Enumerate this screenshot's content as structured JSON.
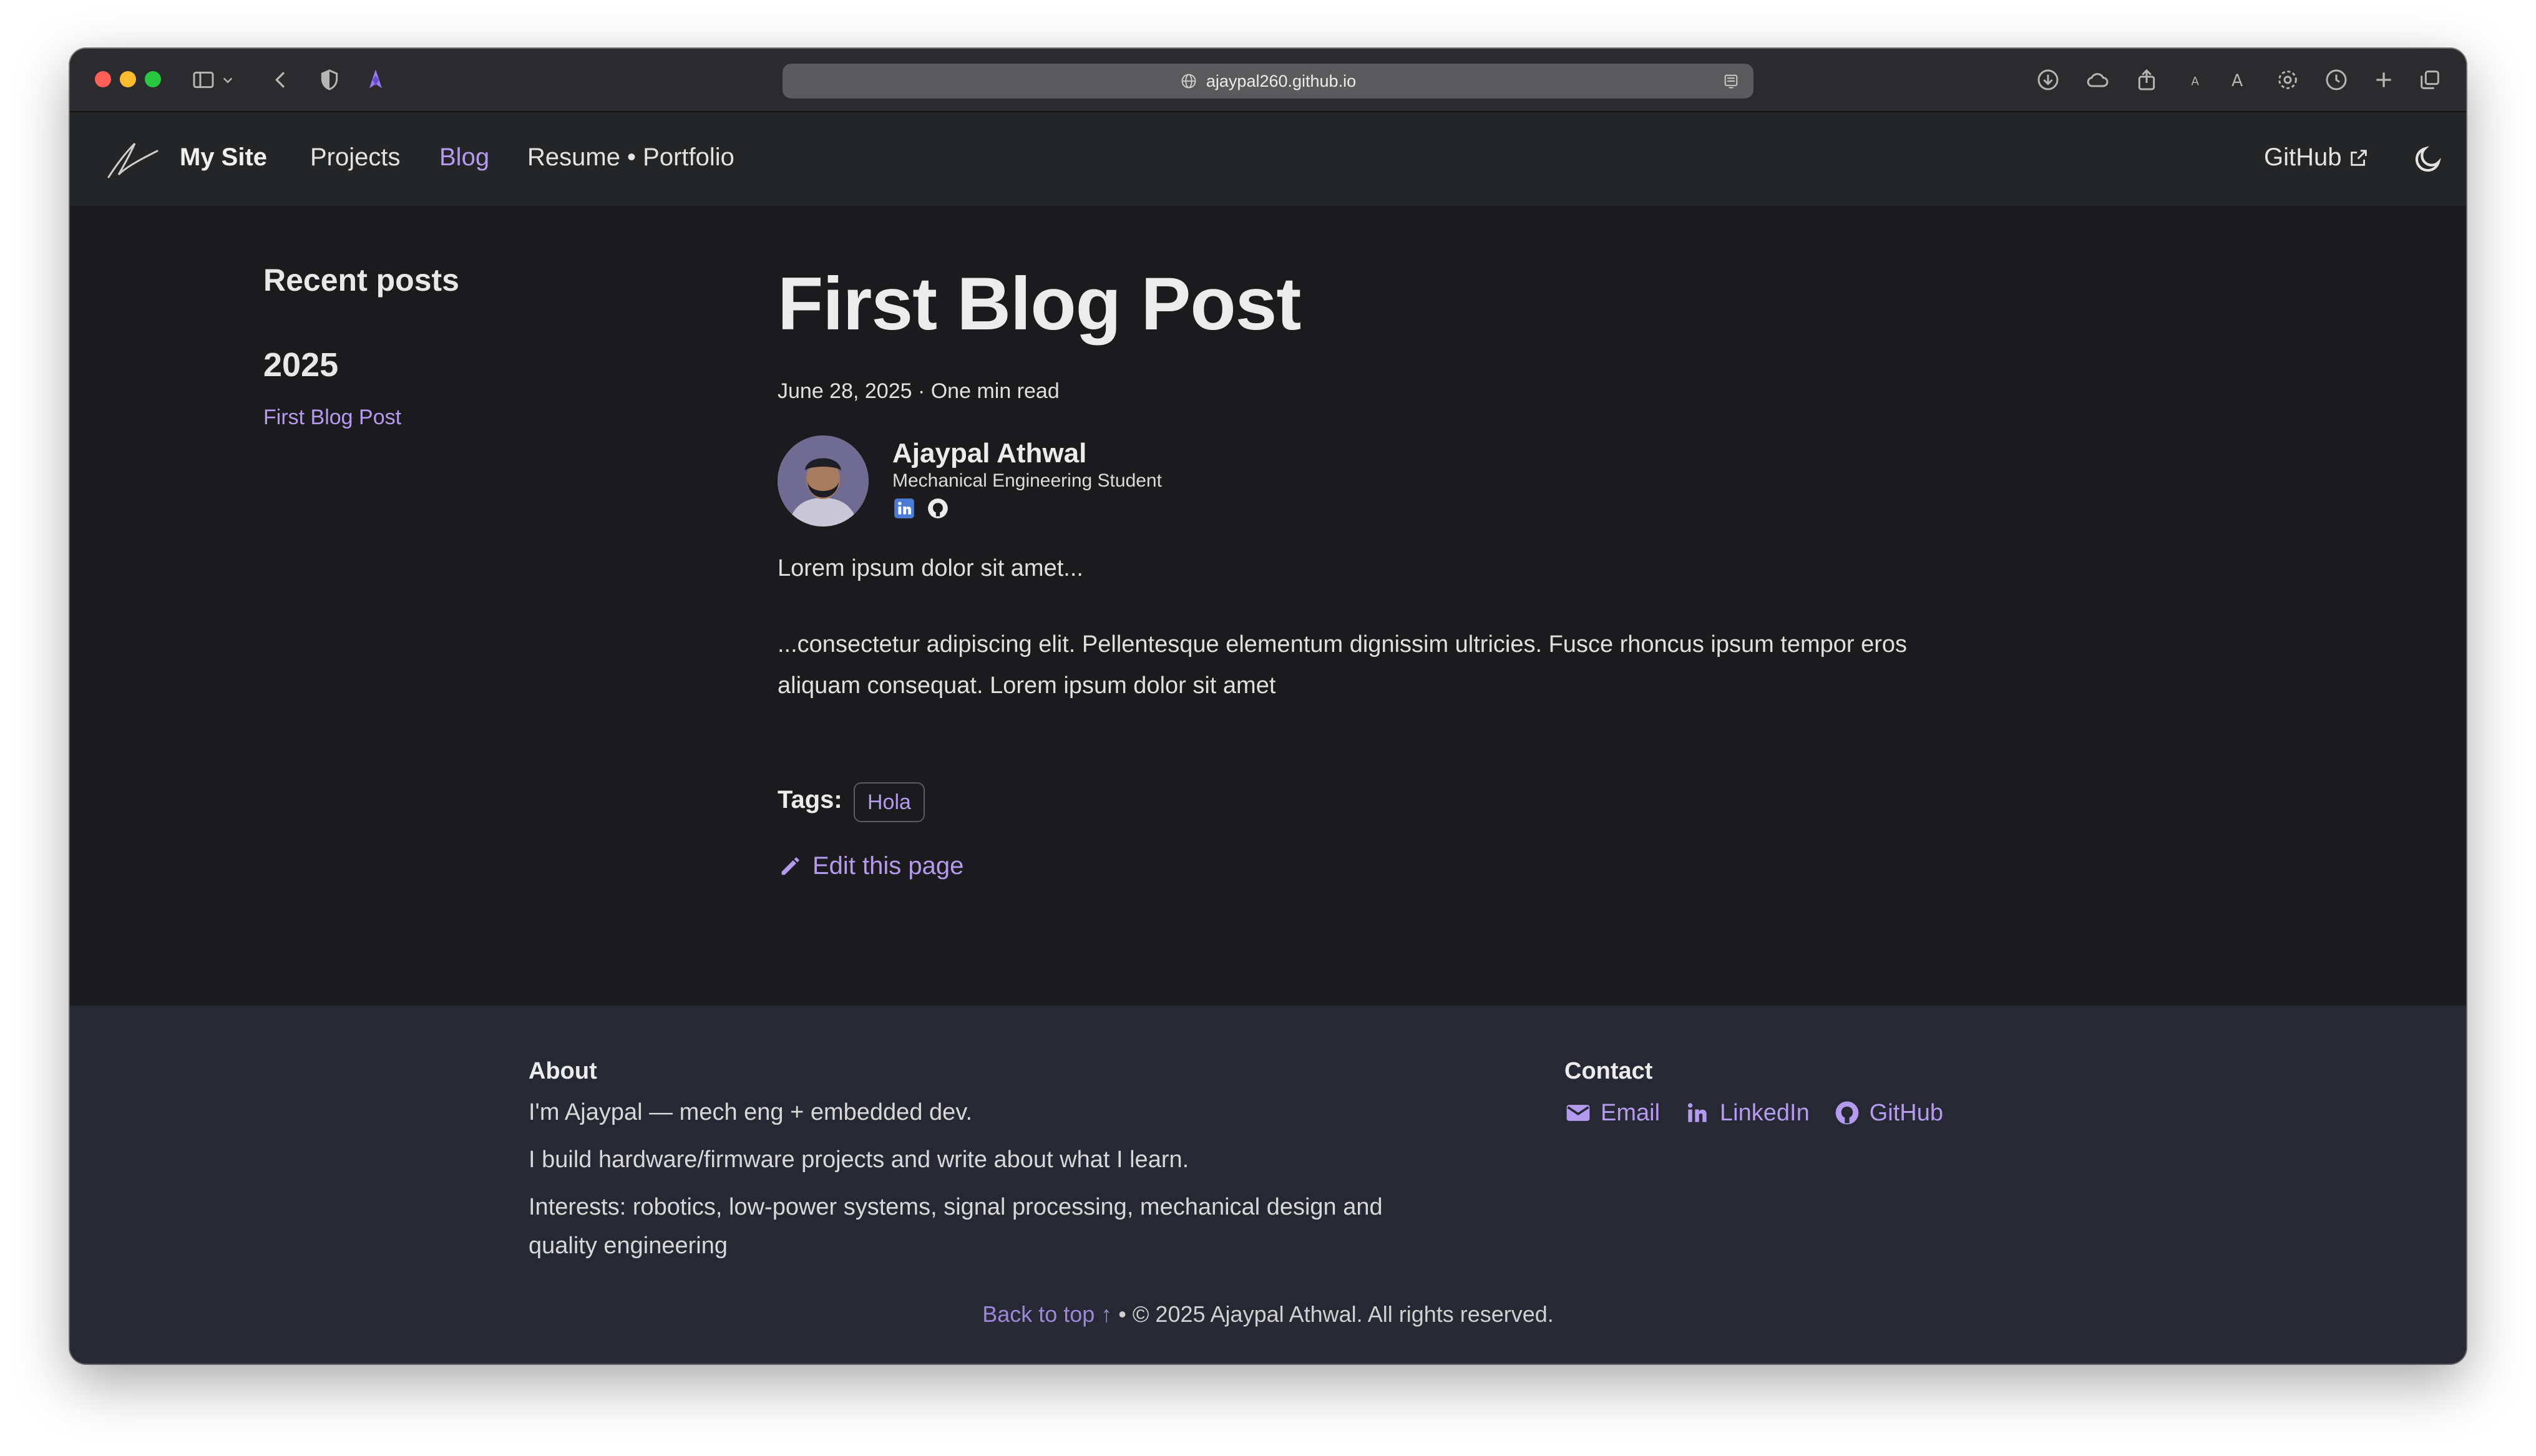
{
  "browser": {
    "url": "ajaypal260.github.io"
  },
  "nav": {
    "brand": "My Site",
    "links": [
      "Projects",
      "Blog",
      "Resume • Portfolio"
    ],
    "github": "GitHub"
  },
  "sidebar": {
    "title": "Recent posts",
    "year": "2025",
    "post": "First Blog Post"
  },
  "post": {
    "title": "First Blog Post",
    "meta": "June 28, 2025 · One min read",
    "author_name": "Ajaypal Athwal",
    "author_title": "Mechanical Engineering Student",
    "p1": "Lorem ipsum dolor sit amet...",
    "p2": "...consectetur adipiscing elit. Pellentesque elementum dignissim ultricies. Fusce rhoncus ipsum tempor eros aliquam consequat. Lorem ipsum dolor sit amet",
    "tags_label": "Tags:",
    "tag": "Hola",
    "edit": "Edit this page"
  },
  "footer": {
    "about_title": "About",
    "about_lines": [
      "I'm Ajaypal — mech eng + embedded dev.",
      "I build hardware/firmware projects and write about what I learn.",
      "Interests: robotics, low-power systems, signal processing, mechanical design and quality engineering"
    ],
    "contact_title": "Contact",
    "contacts": [
      "Email",
      "LinkedIn",
      "GitHub"
    ],
    "back_to_top": "Back to top ↑",
    "copyright": " • © 2025 Ajaypal Athwal. All rights reserved."
  },
  "colors": {
    "accent": "#b59bf0",
    "background": "#1b1b1d",
    "footer_bg": "#262833"
  }
}
